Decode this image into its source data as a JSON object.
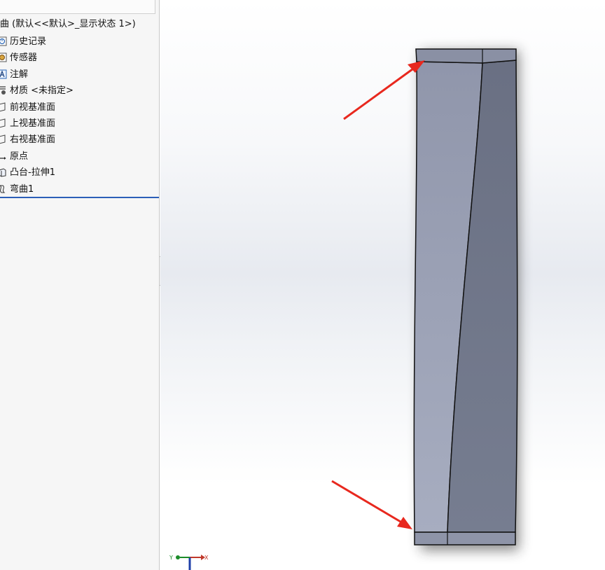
{
  "feature_tree": {
    "root_label": "曲 (默认<<默认>_显示状态 1>)",
    "items": [
      {
        "label": "历史记录",
        "icon": "history-icon"
      },
      {
        "label": "传感器",
        "icon": "sensor-icon"
      },
      {
        "label": "注解",
        "icon": "annotation-icon"
      },
      {
        "label": "材质 <未指定>",
        "icon": "material-icon"
      },
      {
        "label": "前视基准面",
        "icon": "plane-icon"
      },
      {
        "label": "上视基准面",
        "icon": "plane-icon"
      },
      {
        "label": "右视基准面",
        "icon": "plane-icon"
      },
      {
        "label": "原点",
        "icon": "origin-icon"
      },
      {
        "label": "凸台-拉伸1",
        "icon": "extrude-icon"
      },
      {
        "label": "弯曲1",
        "icon": "flex-icon"
      }
    ],
    "rollback_bar_color": "#2c5fb8"
  },
  "viewport": {
    "triad": {
      "x_label": "X",
      "y_label": "Y"
    },
    "part_colors": {
      "front_face": "#9aa0b5",
      "side_face": "#6e7588",
      "edge": "#111111"
    },
    "arrow_color": "#e8281e"
  }
}
